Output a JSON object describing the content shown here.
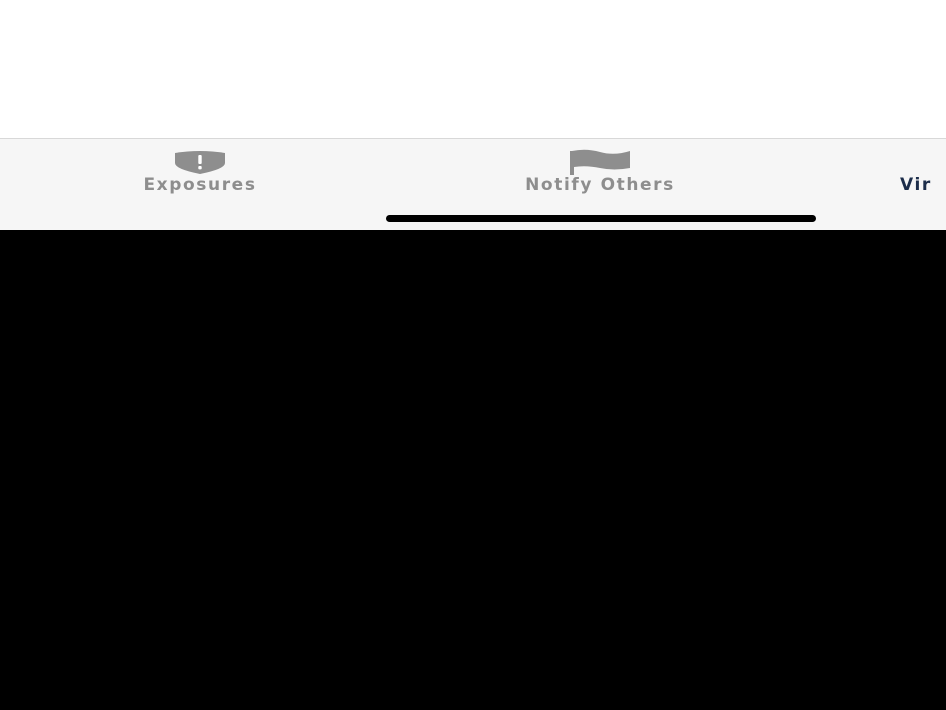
{
  "tab_bar": {
    "tabs": [
      {
        "label": "Exposures",
        "icon": "shield-exclamation-icon",
        "active": false
      },
      {
        "label": "Notify Others",
        "icon": "flag-icon",
        "active": false
      },
      {
        "label": "Vir",
        "icon": "",
        "active": true
      }
    ]
  },
  "colors": {
    "inactive_tab": "#8e8e8e",
    "active_tab": "#1c2d4a",
    "tab_bar_bg": "#f6f6f6",
    "content_bg": "#ffffff"
  }
}
